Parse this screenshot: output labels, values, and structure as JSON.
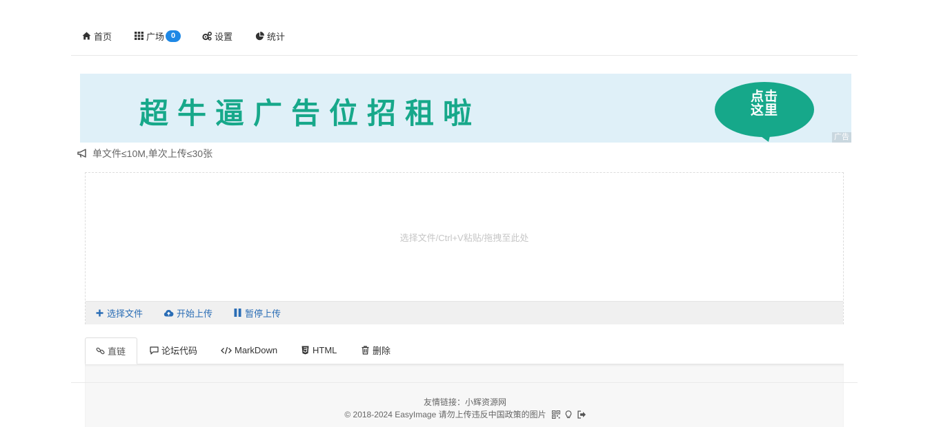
{
  "nav": {
    "home": "首页",
    "square": "广场",
    "square_badge": "0",
    "settings": "设置",
    "stats": "统计"
  },
  "ad": {
    "headline": "超牛逼广告位招租啦",
    "cta_line1": "点击",
    "cta_line2": "这里",
    "tag": "广告",
    "colors": {
      "background": "#dff0f8",
      "text": "#17a88a",
      "bubble": "#16a88a"
    }
  },
  "notice": "单文件≤10M,单次上传≤30张",
  "upload": {
    "drop_hint": "选择文件/Ctrl+V粘贴/拖拽至此处",
    "choose_files": "选择文件",
    "start_upload": "开始上传",
    "pause_upload": "暂停上传"
  },
  "tabs": [
    {
      "label": "直链",
      "icon": "link-icon"
    },
    {
      "label": "论坛代码",
      "icon": "comment-icon"
    },
    {
      "label": "MarkDown",
      "icon": "code-icon"
    },
    {
      "label": "HTML",
      "icon": "html5-icon"
    },
    {
      "label": "删除",
      "icon": "trash-icon"
    }
  ],
  "footer": {
    "links_label": "友情链接：",
    "link_text": "小辉资源网",
    "copyright": "© 2018-2024 EasyImage 请勿上传违反中国政策的图片"
  },
  "colors": {
    "accent": "#2a6db5",
    "badge": "#1e88e5"
  }
}
